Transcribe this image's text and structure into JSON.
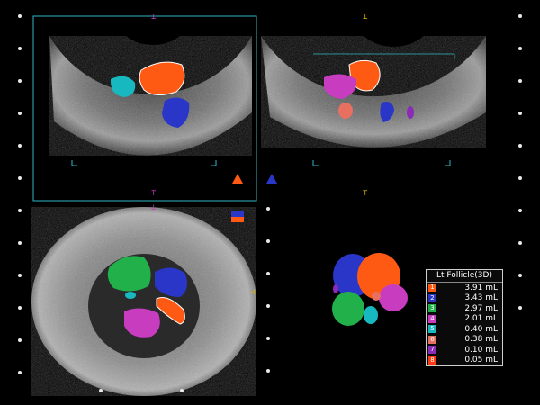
{
  "legend": {
    "title": "Lt Follicle(3D)",
    "items": [
      {
        "index": "1",
        "volume": "3.91 mL",
        "color": "#ff5a14"
      },
      {
        "index": "2",
        "volume": "3.43 mL",
        "color": "#2a36c8"
      },
      {
        "index": "3",
        "volume": "2.97 mL",
        "color": "#22b04a"
      },
      {
        "index": "4",
        "volume": "2.01 mL",
        "color": "#c83cc0"
      },
      {
        "index": "5",
        "volume": "0.40 mL",
        "color": "#18b8c0"
      },
      {
        "index": "6",
        "volume": "0.38 mL",
        "color": "#e87060"
      },
      {
        "index": "7",
        "volume": "0.10 mL",
        "color": "#8a2ab8"
      },
      {
        "index": "8",
        "volume": "0.05 mL",
        "color": "#ff3a10"
      }
    ]
  },
  "colors": {
    "frame": "#2fb6c4",
    "marker": "#d9b400",
    "ultrasound_gray": "#8a8a8a"
  },
  "icons": [
    "orientation-triangle-icon",
    "orientation-triangle-dual-icon",
    "volume-render-indicator-icon"
  ]
}
